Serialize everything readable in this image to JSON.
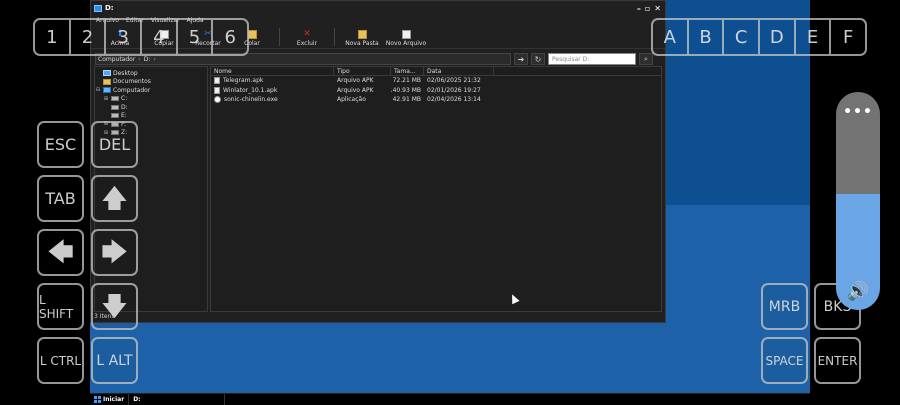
{
  "window": {
    "title": "D:",
    "menu": [
      "Arquivo",
      "Editar",
      "Visualizar",
      "Ajuda"
    ],
    "toolbar": [
      {
        "label": "Acima",
        "icon": "up-folder-icon"
      },
      {
        "label": "Copiar",
        "icon": "copy-icon"
      },
      {
        "label": "Recortar",
        "icon": "cut-icon"
      },
      {
        "label": "Colar",
        "icon": "paste-icon"
      },
      {
        "label": "Excluir",
        "icon": "delete-icon"
      },
      {
        "label": "Nova Pasta",
        "icon": "new-folder-icon"
      },
      {
        "label": "Novo Arquivo",
        "icon": "new-file-icon"
      }
    ],
    "breadcrumb": [
      "Computador",
      "D:"
    ],
    "search_placeholder": "Pesquisar D:",
    "tree": [
      "Desktop",
      "Documentos",
      "Computador",
      "C:",
      "D:",
      "E:",
      "F:",
      "Z:"
    ],
    "columns": {
      "name": "Nome",
      "type": "Tipo",
      "size": "Tama...",
      "date": "Data"
    },
    "files": [
      {
        "name": "Telegram.apk",
        "type": "Arquivo APK",
        "size": "72.21 MB",
        "date": "02/06/2025 21:32"
      },
      {
        "name": "Winlator_10.1.apk",
        "type": "Arquivo APK",
        "size": "140.93 MB",
        "date": "02/01/2026 19:27"
      },
      {
        "name": "sonic-chinelin.exe",
        "type": "Aplicação",
        "size": "42.91 MB",
        "date": "02/04/2026 13:14"
      }
    ],
    "status": "3 Itens"
  },
  "taskbar": {
    "start": "Iniciar",
    "item": "D:"
  },
  "overlay": {
    "numbers": [
      "1",
      "2",
      "3",
      "4",
      "5",
      "6"
    ],
    "letters": [
      "A",
      "B",
      "C",
      "D",
      "E",
      "F"
    ],
    "esc": "ESC",
    "del": "DEL",
    "tab": "TAB",
    "lshift": "L SHIFT",
    "lctrl": "L CTRL",
    "lalt": "L ALT",
    "mrb": "MRB",
    "bksp": "BKS",
    "space": "SPACE",
    "enter": "ENTER",
    "up_arrow": "🡅",
    "left_arrow": "🡄",
    "right_arrow": "🡆",
    "down_arrow": "🡇",
    "volume_menu": "•••",
    "volume_icon": "🔊",
    "volume_level": 0.53
  }
}
